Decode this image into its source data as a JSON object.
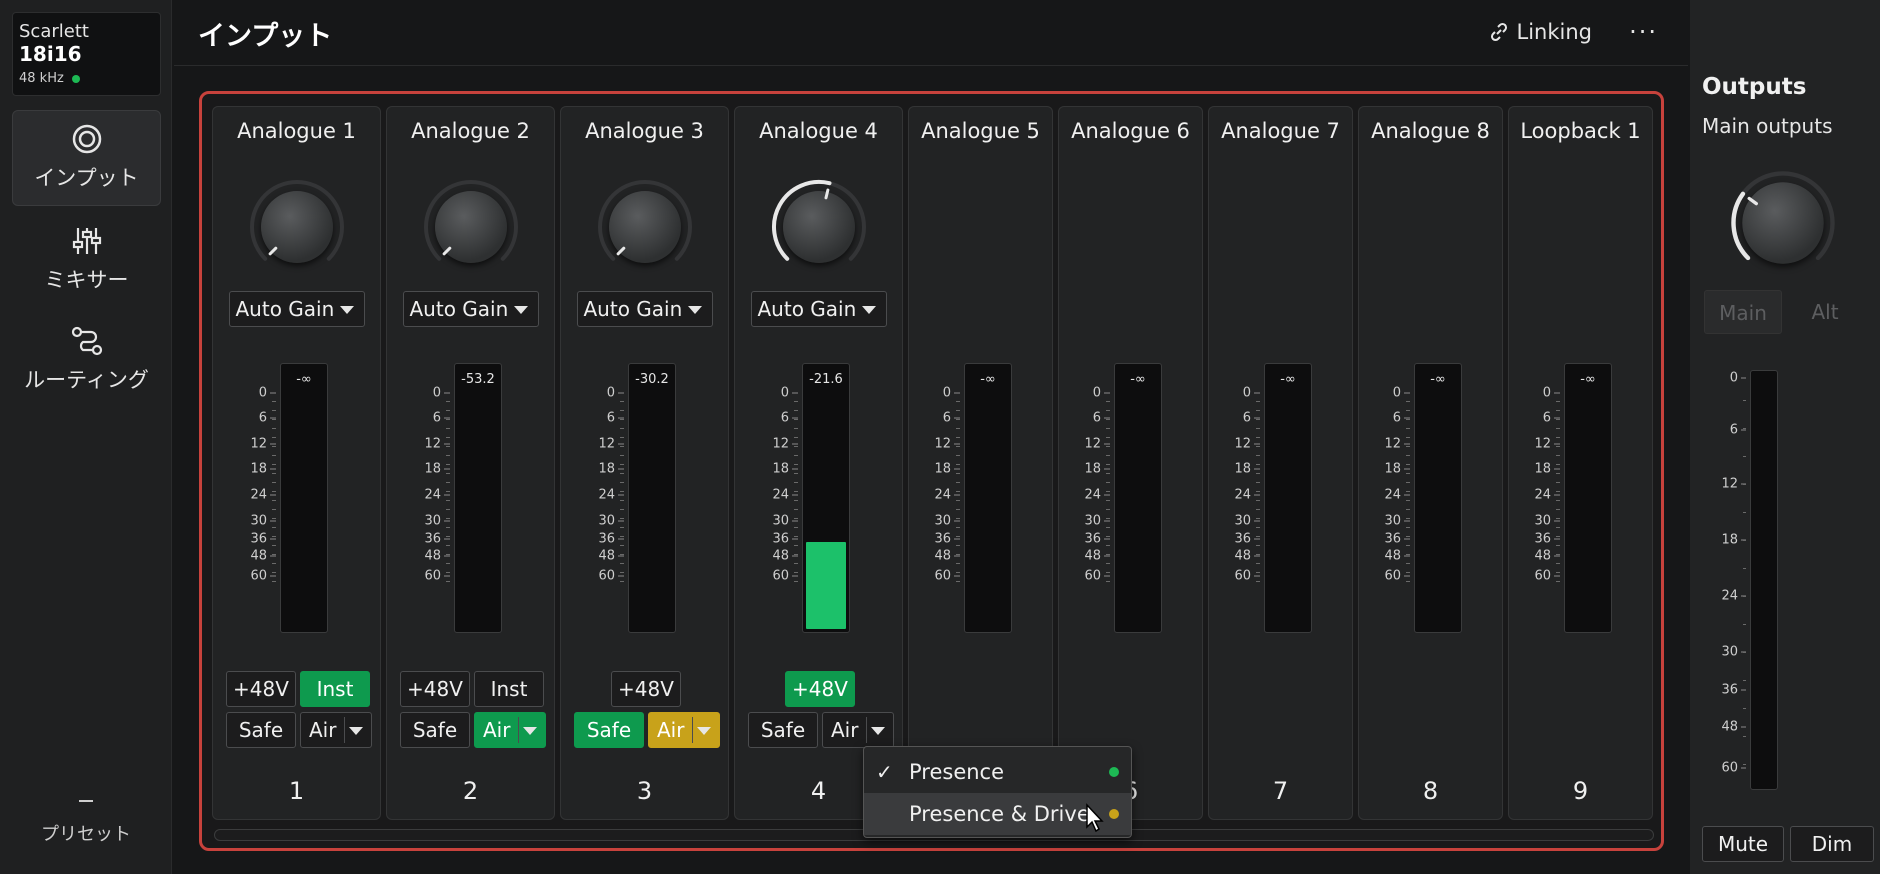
{
  "device": {
    "line1": "Scarlett",
    "line2": "18i16",
    "sample_rate": "48 kHz",
    "status_color": "#1db954"
  },
  "nav": [
    {
      "label": "インプット",
      "icon": "input-icon",
      "active": true
    },
    {
      "label": "ミキサー",
      "icon": "mixer-icon",
      "active": false
    },
    {
      "label": "ルーティング",
      "icon": "routing-icon",
      "active": false
    }
  ],
  "preset_label": "プリセット",
  "header": {
    "title": "インプット",
    "linking_label": "Linking",
    "more_label": "···"
  },
  "scale_labels": [
    "0",
    "6",
    "12",
    "18",
    "24",
    "30",
    "36",
    "48",
    "60"
  ],
  "channels": [
    {
      "name": "Analogue 1",
      "number": "1",
      "knob": true,
      "gain_label": "Auto Gain",
      "gain_level": 0.0,
      "peak": "-∞",
      "meter_level": 0.0,
      "phantom": {
        "label": "+48V",
        "on": false
      },
      "inst": {
        "label": "Inst",
        "on": true
      },
      "safe": {
        "label": "Safe",
        "on": false
      },
      "air": {
        "label": "Air",
        "state": "off"
      }
    },
    {
      "name": "Analogue 2",
      "number": "2",
      "knob": true,
      "gain_label": "Auto Gain",
      "gain_level": 0.0,
      "peak": "-53.2",
      "meter_level": 0.0,
      "phantom": {
        "label": "+48V",
        "on": false
      },
      "inst": {
        "label": "Inst",
        "on": false
      },
      "safe": {
        "label": "Safe",
        "on": false
      },
      "air": {
        "label": "Air",
        "state": "presence"
      }
    },
    {
      "name": "Analogue 3",
      "number": "3",
      "knob": true,
      "gain_label": "Auto Gain",
      "gain_level": 0.0,
      "peak": "-30.2",
      "meter_level": 0.0,
      "phantom": {
        "label": "+48V",
        "on": false
      },
      "safe": {
        "label": "Safe",
        "on": true
      },
      "air": {
        "label": "Air",
        "state": "drive"
      }
    },
    {
      "name": "Analogue 4",
      "number": "4",
      "knob": true,
      "gain_label": "Auto Gain",
      "gain_level": 0.55,
      "peak": "-21.6",
      "meter_level": 0.33,
      "phantom": {
        "label": "+48V",
        "on": true
      },
      "safe": {
        "label": "Safe",
        "on": false
      },
      "air": {
        "label": "Air",
        "state": "off",
        "open": true
      }
    },
    {
      "name": "Analogue 5",
      "number": "5",
      "knob": false,
      "peak": "-∞",
      "meter_level": 0.0
    },
    {
      "name": "Analogue 6",
      "number": "6",
      "knob": false,
      "peak": "-∞",
      "meter_level": 0.0
    },
    {
      "name": "Analogue 7",
      "number": "7",
      "knob": false,
      "peak": "-∞",
      "meter_level": 0.0
    },
    {
      "name": "Analogue 8",
      "number": "8",
      "knob": false,
      "peak": "-∞",
      "meter_level": 0.0
    },
    {
      "name": "Loopback 1",
      "number": "9",
      "knob": false,
      "peak": "-∞",
      "meter_level": 0.0
    }
  ],
  "air_dropdown": {
    "items": [
      {
        "label": "Presence",
        "checked": true,
        "color": "#1db954"
      },
      {
        "label": "Presence & Drive",
        "checked": false,
        "color": "#c8a21a"
      }
    ]
  },
  "outputs": {
    "title": "Outputs",
    "subtitle": "Main outputs",
    "knob_level": 0.3,
    "main_label": "Main",
    "alt_label": "Alt",
    "scale_labels": [
      "0",
      "6",
      "12",
      "18",
      "24",
      "30",
      "36",
      "48",
      "60"
    ],
    "mute_label": "Mute",
    "dim_label": "Dim"
  },
  "colors": {
    "accent_red": "#c7423c",
    "green": "#0e9a4e",
    "gold": "#c8a21a",
    "meter_green": "#1cc16a"
  }
}
